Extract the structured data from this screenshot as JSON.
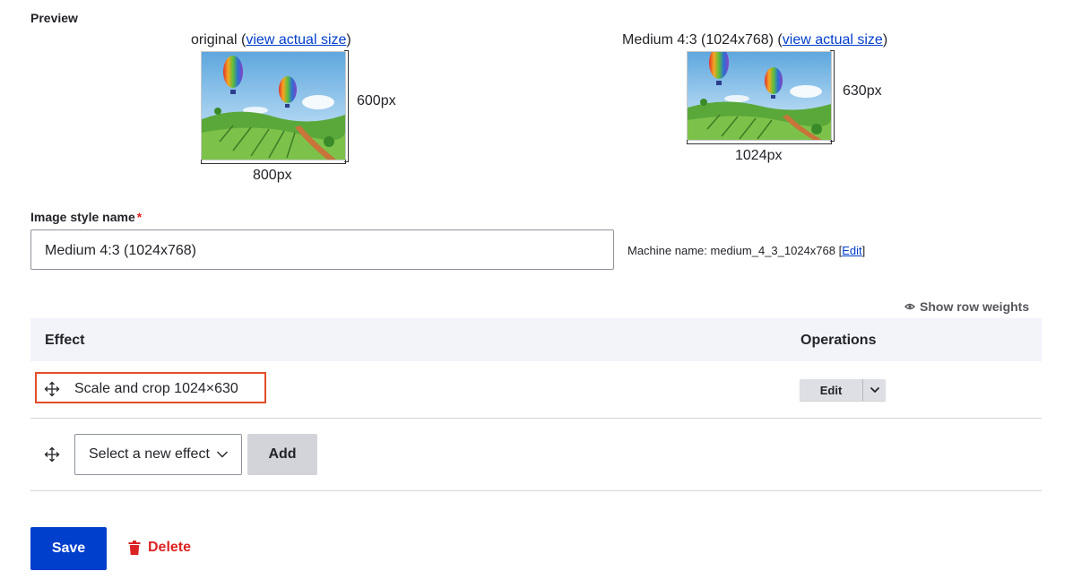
{
  "preview": {
    "label": "Preview",
    "original": {
      "caption_prefix": "original (",
      "link": "view actual size",
      "caption_suffix": ")",
      "height_label": "600px",
      "width_label": "800px"
    },
    "derivative": {
      "caption_prefix": "Medium 4:3 (1024x768) (",
      "link": "view actual size",
      "caption_suffix": ")",
      "height_label": "630px",
      "width_label": "1024px"
    }
  },
  "form": {
    "name_label": "Image style name",
    "required_mark": "*",
    "name_value": "Medium 4:3 (1024x768)",
    "machine_prefix": "Machine name: medium_4_3_1024x768 [",
    "machine_edit": "Edit",
    "machine_suffix": "]"
  },
  "table": {
    "show_row_weights": "Show row weights",
    "col_effect": "Effect",
    "col_operations": "Operations",
    "rows": [
      {
        "effect": "Scale and crop 1024×630",
        "op_label": "Edit"
      }
    ],
    "new_effect": {
      "select_value": "Select a new effect",
      "add_label": "Add"
    }
  },
  "actions": {
    "save": "Save",
    "delete": "Delete"
  },
  "colors": {
    "primary": "#003ecc",
    "danger": "#dc2323",
    "highlight": "#e14d2a"
  }
}
